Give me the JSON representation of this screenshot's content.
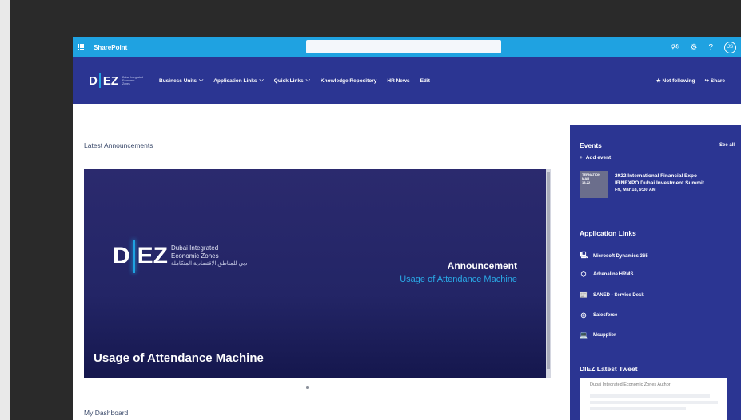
{
  "suitebar": {
    "brand": "SharePoint",
    "avatar_initials": "JS",
    "icons": [
      "waffle-icon",
      "megaphone-icon",
      "gear-icon",
      "help-icon"
    ]
  },
  "header": {
    "logo": {
      "d": "D",
      "ez": "EZ",
      "small": "Dubai Integrated Economic Zones"
    },
    "nav": [
      {
        "label": "Business Units",
        "dropdown": true
      },
      {
        "label": "Application Links",
        "dropdown": true
      },
      {
        "label": "Quick Links",
        "dropdown": true
      },
      {
        "label": "Knowledge Repository",
        "dropdown": false
      },
      {
        "label": "HR News",
        "dropdown": false
      },
      {
        "label": "Edit",
        "dropdown": false
      }
    ],
    "follow": "Not following",
    "share": "Share"
  },
  "main": {
    "latest_title": "Latest Announcements",
    "hero": {
      "logo_d": "D",
      "logo_ez": "EZ",
      "logo_name_1": "Dubai Integrated",
      "logo_name_2": "Economic Zones",
      "logo_arabic": "دبي للمناطق الاقتصادية المتكاملة",
      "announcement": "Announcement",
      "announcement_sub": "Usage of Attendance Machine",
      "caption": "Usage of Attendance Machine"
    },
    "dashboard_title": "My Dashboard"
  },
  "panel": {
    "events_title": "Events",
    "see_all": "See all",
    "add_event": "Add event",
    "event": {
      "thumb_line1": "TERNATION",
      "thumb_line2": "MAR",
      "thumb_line3": "18-22",
      "title_line1": "2022 International Financial Expo",
      "title_line2": "IFINEXPO Dubai Investment Summit",
      "date": "Fri, Mar 18, 9:30 AM"
    },
    "app_links_title": "Application Links",
    "app_links": [
      {
        "label": "Microsoft Dynamics 365",
        "icon": "dynamics-icon"
      },
      {
        "label": "Adrenaline HRMS",
        "icon": "hexagon-icon"
      },
      {
        "label": "SANED - Service Desk",
        "icon": "servicedesk-icon"
      },
      {
        "label": "Salesforce",
        "icon": "salesforce-icon"
      },
      {
        "label": "Msupplier",
        "icon": "laptop-icon"
      }
    ],
    "tweet_title": "DIEZ Latest Tweet",
    "tweet_author": "Dubai Integrated Economic Zones Author"
  },
  "colors": {
    "suitebar": "#1fa2e1",
    "header": "#2b3592",
    "panel": "#2b3592",
    "accent": "#2aa9e6"
  }
}
